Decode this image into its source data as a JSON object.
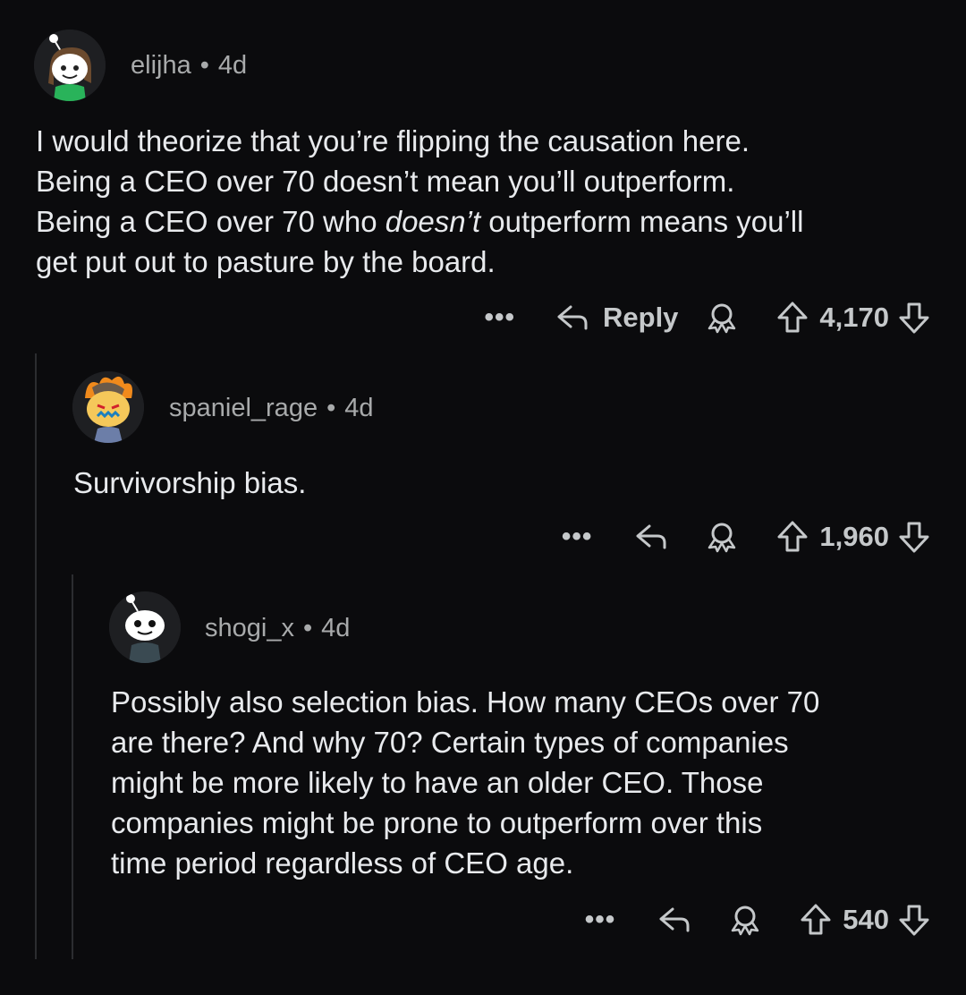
{
  "comments": [
    {
      "username": "elijha",
      "separator": "•",
      "age": "4d",
      "lines": [
        [
          {
            "t": "I would theorize that you’re flipping the causation here.",
            "i": false
          }
        ],
        [
          {
            "t": "Being a CEO over 70 doesn’t mean you’ll outperform.",
            "i": false
          }
        ],
        [
          {
            "t": "Being a CEO over 70 who ",
            "i": false
          },
          {
            "t": "doesn’t",
            "i": true
          },
          {
            "t": " outperform means you’ll",
            "i": false
          }
        ],
        [
          {
            "t": "get put out to pasture by the board.",
            "i": false
          }
        ]
      ],
      "more": "•••",
      "reply_label": "Reply",
      "votes": "4,170"
    },
    {
      "username": "spaniel_rage",
      "separator": "•",
      "age": "4d",
      "lines": [
        [
          {
            "t": "Survivorship bias.",
            "i": false
          }
        ]
      ],
      "more": "•••",
      "reply_label": "",
      "votes": "1,960"
    },
    {
      "username": "shogi_x",
      "separator": "•",
      "age": "4d",
      "lines": [
        [
          {
            "t": "Possibly also selection bias. How many CEOs over 70",
            "i": false
          }
        ],
        [
          {
            "t": "are there? And why 70? Certain types of companies",
            "i": false
          }
        ],
        [
          {
            "t": "might be more likely to have an older CEO. Those",
            "i": false
          }
        ],
        [
          {
            "t": "companies might be prone to outperform over this",
            "i": false
          }
        ],
        [
          {
            "t": "time period regardless of CEO age.",
            "i": false
          }
        ]
      ],
      "more": "•••",
      "reply_label": "",
      "votes": "540"
    }
  ],
  "icons": {
    "reply": "reply-arrow-icon",
    "award": "award-icon",
    "upvote": "upvote-arrow-icon",
    "downvote": "downvote-arrow-icon",
    "more": "more-options-icon"
  },
  "colors": {
    "background": "#0b0b0d",
    "text": "#e8eaed",
    "meta": "#a8aaab",
    "thread_line": "#2c2d30"
  }
}
